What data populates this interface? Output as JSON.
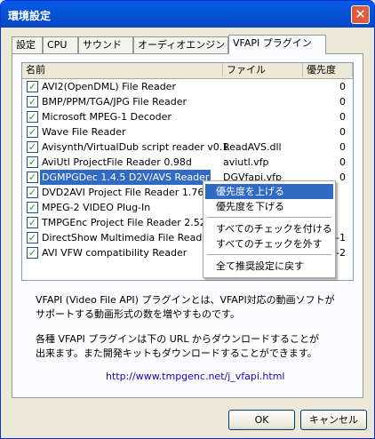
{
  "window": {
    "title": "環境設定",
    "close_label": "✕"
  },
  "tabs": [
    "設定",
    "CPU",
    "サウンド",
    "オーディオエンジン",
    "VFAPI プラグイン"
  ],
  "list": {
    "columns": [
      "名前",
      "ファイル",
      "優先度"
    ],
    "rows": [
      {
        "name": "AVI2(OpenDML) File Reader",
        "file": "",
        "priority": "0",
        "checked": true
      },
      {
        "name": "BMP/PPM/TGA/JPG File Reader",
        "file": "",
        "priority": "0",
        "checked": true
      },
      {
        "name": "Microsoft MPEG-1 Decoder",
        "file": "",
        "priority": "0",
        "checked": true
      },
      {
        "name": "Wave File Reader",
        "file": "",
        "priority": "0",
        "checked": true
      },
      {
        "name": "Avisynth/VirtualDub script reader v0.1",
        "file": "ReadAVS.dll",
        "priority": "0",
        "checked": true
      },
      {
        "name": "AviUtl ProjectFile Reader 0.98d",
        "file": "aviutl.vfp",
        "priority": "0",
        "checked": true
      },
      {
        "name": "DGMPGDec 1.4.5 D2V/AVS Reader",
        "file": "DGVfapi.vfp",
        "priority": "0",
        "checked": true
      },
      {
        "name": "DVD2AVI Project File Reader 1.76+",
        "file": "",
        "priority": "",
        "checked": true
      },
      {
        "name": "MPEG-2 VIDEO Plug-In",
        "file": "",
        "priority": "",
        "checked": true
      },
      {
        "name": "TMPGEnc Project File Reader 2.524",
        "file": "",
        "priority": "",
        "checked": true
      },
      {
        "name": "DirectShow Multimedia File Reader",
        "file": "",
        "priority": "-1",
        "checked": true
      },
      {
        "name": "AVI VFW compatibility Reader",
        "file": "",
        "priority": "-2",
        "checked": true
      }
    ]
  },
  "context_menu": {
    "items": [
      "優先度を上げる",
      "優先度を下げる",
      "すべてのチェックを付ける",
      "すべてのチェックを外す",
      "全て推奨設定に戻す"
    ]
  },
  "description": {
    "lines": [
      "VFAPI (Video File API) プラグインとは、VFAPI対応の動画ソフトが",
      "サポートする動画形式の数を増やすものです。",
      "各種 VFAPI プラグインは下の URL からダウンロードすることが",
      "出来ます。また開発キットもダウンロードすることができます。"
    ],
    "url": "http://www.tmpgenc.net/j_vfapi.html"
  },
  "buttons": {
    "ok": "OK",
    "cancel": "キャンセル"
  }
}
